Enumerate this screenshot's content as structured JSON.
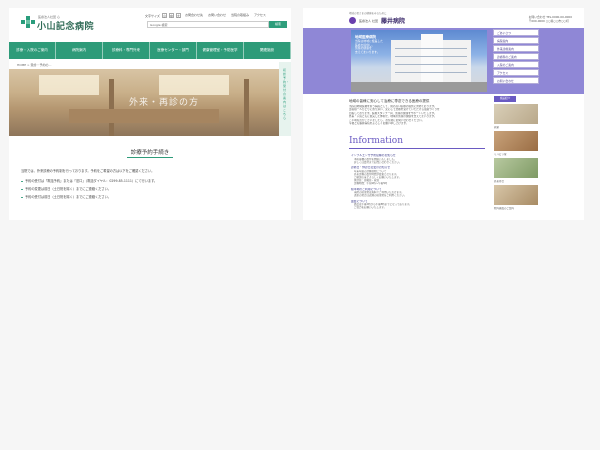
{
  "koyama": {
    "logo_sub": "医療法人社団 心",
    "logo_name": "小山記念病院",
    "font_size_label": "文字サイズ",
    "font_sizes": [
      "小",
      "中",
      "大"
    ],
    "top_links": [
      "お問合わせ先",
      "お問い合わせ",
      "当院の取組み",
      "アクセス"
    ],
    "search_placeholder": "Google 検索",
    "search_button": "検索",
    "nav": [
      "診療・入院のご案内",
      "病院案内",
      "診療科・専門外来",
      "医療センター・部門",
      "健康管理室・予防医学",
      "関連施設"
    ],
    "breadcrumb": "HOME > 受診・予約の…",
    "hero_title": "外来・再診の方",
    "side_vertical": "初診予約・受付の案内はこちら",
    "page_title": "診療予約手続き",
    "intro": "当院では、外来診療の予約制を行っております。予約をご希望の方は以下をご確認ください。",
    "list": [
      "予約の受付は「電話予約」または「窓口」（電話ダイヤル：0299-85-1111）にて行います。",
      "予約の変更は前日（土日祝を除く）までにご連絡ください。",
      "予約の受付は前日（土日祝を除く）までにご連絡ください。"
    ]
  },
  "fujii": {
    "slogan": "地域の皆さまの健康を守るために",
    "corp": "医療法人 社団",
    "name": "藤井病院",
    "contact": [
      "お問い合わせ TEL.0000-00-0000",
      "〒000-0000 ○○県○○市○○町"
    ],
    "photo_text": {
      "heading": "地域医療病院",
      "lines": [
        "当院は地域に根差した",
        "医療を提供し、",
        "皆様の健康を",
        "支えてまいります。"
      ]
    },
    "menu": [
      "ごあいさつ",
      "病院案内",
      "外来診療案内",
      "診療科のご案内",
      "入院のご案内",
      "アクセス",
      "お問い合わせ"
    ],
    "intro_title": "地域の皆様に安心して治療に専念できる医療の提供",
    "intro_lines": [
      "当院は地域医療を担う病院として、質の高い医療の提供に努めております。",
      "患者様一人ひとりに寄り添い、安心して治療を受けていただける環境づくりを",
      "目指しております。医療スタッフ一同、皆様の健康をサポートいたします。",
      "外来・入院ともに充実した体制で、地域の皆様の健康を支えてまいります。",
      "ご不明な点がございましたら、お気軽にお問い合わせください。",
      "今後とも藤井病院をよろしくお願い申し上げます。"
    ],
    "info_heading": "Information",
    "news": [
      {
        "title": "インフルエンザ予防接種のお知らせ",
        "details": [
          "予防接種の受付を開始いたしました。",
          "詳しくは受付までお問い合わせください。"
        ]
      },
      {
        "title": "診療日・休診日変更のお知らせ",
        "details": [
          "年末年始の診療日程について",
          "外来診療の受付時間が変更となります。",
          "ご確認のほどよろしくお願いいたします。",
          "休診日：日曜日・祝日",
          "診療時間：午前9時〜午後5時"
        ]
      },
      {
        "title": "駐車場のご利用について",
        "details": [
          "当院の駐車場は無料でご利用いただけます。",
          "満車の場合は近隣の駐車場をご利用ください。"
        ]
      },
      {
        "title": "面会について",
        "details": [
          "面会は午後2時から午後8時までとなっております。",
          "ご協力をお願いいたします。"
        ]
      }
    ],
    "aside_heading": "施設紹介",
    "aside_captions": [
      "病室",
      "リハビリ室",
      "外来待合",
      "院内施設のご案内"
    ]
  }
}
